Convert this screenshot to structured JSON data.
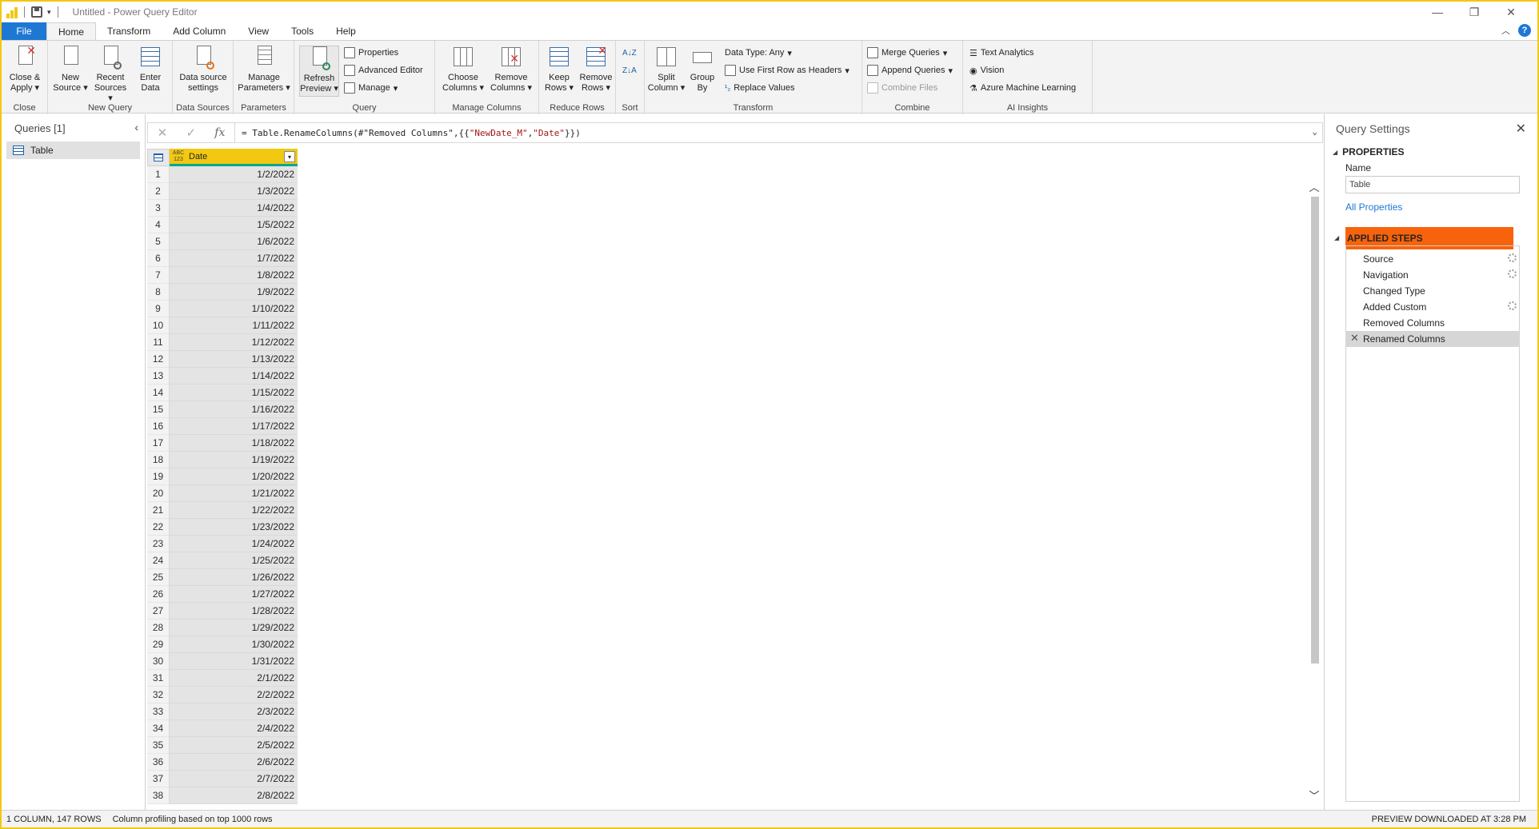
{
  "window": {
    "title": "Untitled - Power Query Editor",
    "help_label": "?"
  },
  "menu": {
    "tabs": [
      "File",
      "Home",
      "Transform",
      "Add Column",
      "View",
      "Tools",
      "Help"
    ]
  },
  "ribbon": {
    "close": {
      "close_apply": "Close & Apply",
      "group": "Close"
    },
    "new_query": {
      "new_source": "New Source",
      "recent_sources": "Recent Sources",
      "enter_data": "Enter Data",
      "group": "New Query"
    },
    "data_sources": {
      "settings": "Data source settings",
      "group": "Data Sources"
    },
    "parameters": {
      "manage": "Manage Parameters",
      "group": "Parameters"
    },
    "query": {
      "refresh": "Refresh Preview",
      "properties": "Properties",
      "advanced_editor": "Advanced Editor",
      "manage": "Manage",
      "group": "Query"
    },
    "manage_columns": {
      "choose": "Choose Columns",
      "remove": "Remove Columns",
      "group": "Manage Columns"
    },
    "reduce_rows": {
      "keep": "Keep Rows",
      "remove": "Remove Rows",
      "group": "Reduce Rows"
    },
    "sort": {
      "group": "Sort"
    },
    "transform": {
      "split": "Split Column",
      "group_by": "Group By",
      "data_type": "Data Type: Any",
      "first_row": "Use First Row as Headers",
      "replace": "Replace Values",
      "group": "Transform"
    },
    "combine": {
      "merge": "Merge Queries",
      "append": "Append Queries",
      "combine_files": "Combine Files",
      "group": "Combine"
    },
    "ai": {
      "text_analytics": "Text Analytics",
      "vision": "Vision",
      "azure_ml": "Azure Machine Learning",
      "group": "AI Insights"
    }
  },
  "queries": {
    "header": "Queries [1]",
    "items": [
      "Table"
    ]
  },
  "formula": {
    "prefix": "= Table.RenameColumns(#\"Removed Columns\",{{",
    "str1": "\"NewDate_M\"",
    "mid": ", ",
    "str2": "\"Date\"",
    "suffix": "}})"
  },
  "grid": {
    "type_icon": "ABC 123",
    "column": "Date",
    "rows": [
      "1/2/2022",
      "1/3/2022",
      "1/4/2022",
      "1/5/2022",
      "1/6/2022",
      "1/7/2022",
      "1/8/2022",
      "1/9/2022",
      "1/10/2022",
      "1/11/2022",
      "1/12/2022",
      "1/13/2022",
      "1/14/2022",
      "1/15/2022",
      "1/16/2022",
      "1/17/2022",
      "1/18/2022",
      "1/19/2022",
      "1/20/2022",
      "1/21/2022",
      "1/22/2022",
      "1/23/2022",
      "1/24/2022",
      "1/25/2022",
      "1/26/2022",
      "1/27/2022",
      "1/28/2022",
      "1/29/2022",
      "1/30/2022",
      "1/31/2022",
      "2/1/2022",
      "2/2/2022",
      "2/3/2022",
      "2/4/2022",
      "2/5/2022",
      "2/6/2022",
      "2/7/2022",
      "2/8/2022"
    ]
  },
  "settings": {
    "title": "Query Settings",
    "properties": "PROPERTIES",
    "name_label": "Name",
    "name_value": "Table",
    "all_properties": "All Properties",
    "applied_steps": "APPLIED STEPS",
    "steps": [
      {
        "label": "Source",
        "gear": true
      },
      {
        "label": "Navigation",
        "gear": true
      },
      {
        "label": "Changed Type",
        "gear": false
      },
      {
        "label": "Added Custom",
        "gear": true
      },
      {
        "label": "Removed Columns",
        "gear": false
      },
      {
        "label": "Renamed Columns",
        "gear": false,
        "selected": true
      }
    ]
  },
  "status": {
    "rows": "1 COLUMN, 147 ROWS",
    "profiling": "Column profiling based on top 1000 rows",
    "preview": "PREVIEW DOWNLOADED AT 3:28 PM"
  },
  "colors": {
    "accent": "#f2c811",
    "file_tab": "#1f77d4",
    "highlight": "#f7630c",
    "column_underline": "#00a88f"
  }
}
